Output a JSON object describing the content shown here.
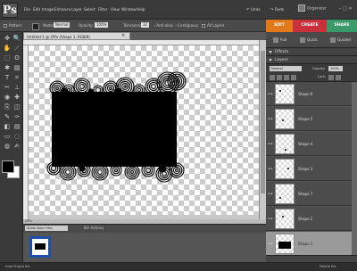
{
  "menubar": {
    "app_icon": "Ps",
    "items": [
      "File",
      "Edit",
      "Image",
      "Enhance",
      "Layer",
      "Select",
      "Filter",
      "View",
      "Window",
      "Help"
    ],
    "undo": "Undo",
    "redo": "Redo",
    "organizer": "Organizer",
    "window_controls": "– □ ✕"
  },
  "options": {
    "pattern": "Pattern",
    "mode_label": "Mode:",
    "mode_value": "Normal",
    "opacity_label": "Opacity:",
    "opacity_value": "100%",
    "tolerance_label": "Tolerance:",
    "tolerance_value": "32",
    "antialias": "Anti-alias",
    "contiguous": "Contiguous",
    "all_layers": "All Layers"
  },
  "mode_tabs": {
    "edit": "EDIT",
    "create": "CREATE",
    "share": "SHARE"
  },
  "edit_modes": {
    "full": "Full",
    "quick": "Quick",
    "guided": "Guided"
  },
  "document": {
    "tab_title": "Untitled-1 @ 29% (Shape 1, RGB/8)",
    "close": "×",
    "status": "29%"
  },
  "project_bin": {
    "dropdown": "Show Open Files",
    "actions": "Bin Actions"
  },
  "footer": {
    "hide_bin": "Hide Project Bin",
    "palette_bin": "Palette Bin"
  },
  "effects_panel": {
    "title": "Effects"
  },
  "layers_panel": {
    "title": "Layers",
    "blend_mode": "Normal",
    "opacity_label": "Opacity:",
    "opacity_value": "100%",
    "lock_label": "Lock:",
    "layers": [
      {
        "name": "Shape 6"
      },
      {
        "name": "Shape 5"
      },
      {
        "name": "Shape 4"
      },
      {
        "name": "Shape 3"
      },
      {
        "name": "Shape 7"
      },
      {
        "name": "Shape 2"
      },
      {
        "name": "Shape 1",
        "selected": true
      }
    ]
  },
  "colors": {
    "edit_tab": "#e07a1a",
    "create_tab": "#c8303c",
    "share_tab": "#3a9a6a",
    "foreground": "#000000",
    "background": "#ffffff"
  },
  "icons": {
    "tools": [
      "move-icon",
      "zoom-icon",
      "hand-icon",
      "eyedropper-icon",
      "marquee-icon",
      "lasso-icon",
      "magic-wand-icon",
      "selection-brush-icon",
      "type-icon",
      "crop-icon",
      "cookie-cutter-icon",
      "straighten-icon",
      "red-eye-icon",
      "healing-brush-icon",
      "clone-stamp-icon",
      "eraser-icon",
      "brush-icon",
      "smart-brush-icon",
      "paint-bucket-icon",
      "gradient-icon",
      "shape-icon",
      "blur-icon",
      "sponge-icon",
      "color-replace-icon"
    ]
  }
}
